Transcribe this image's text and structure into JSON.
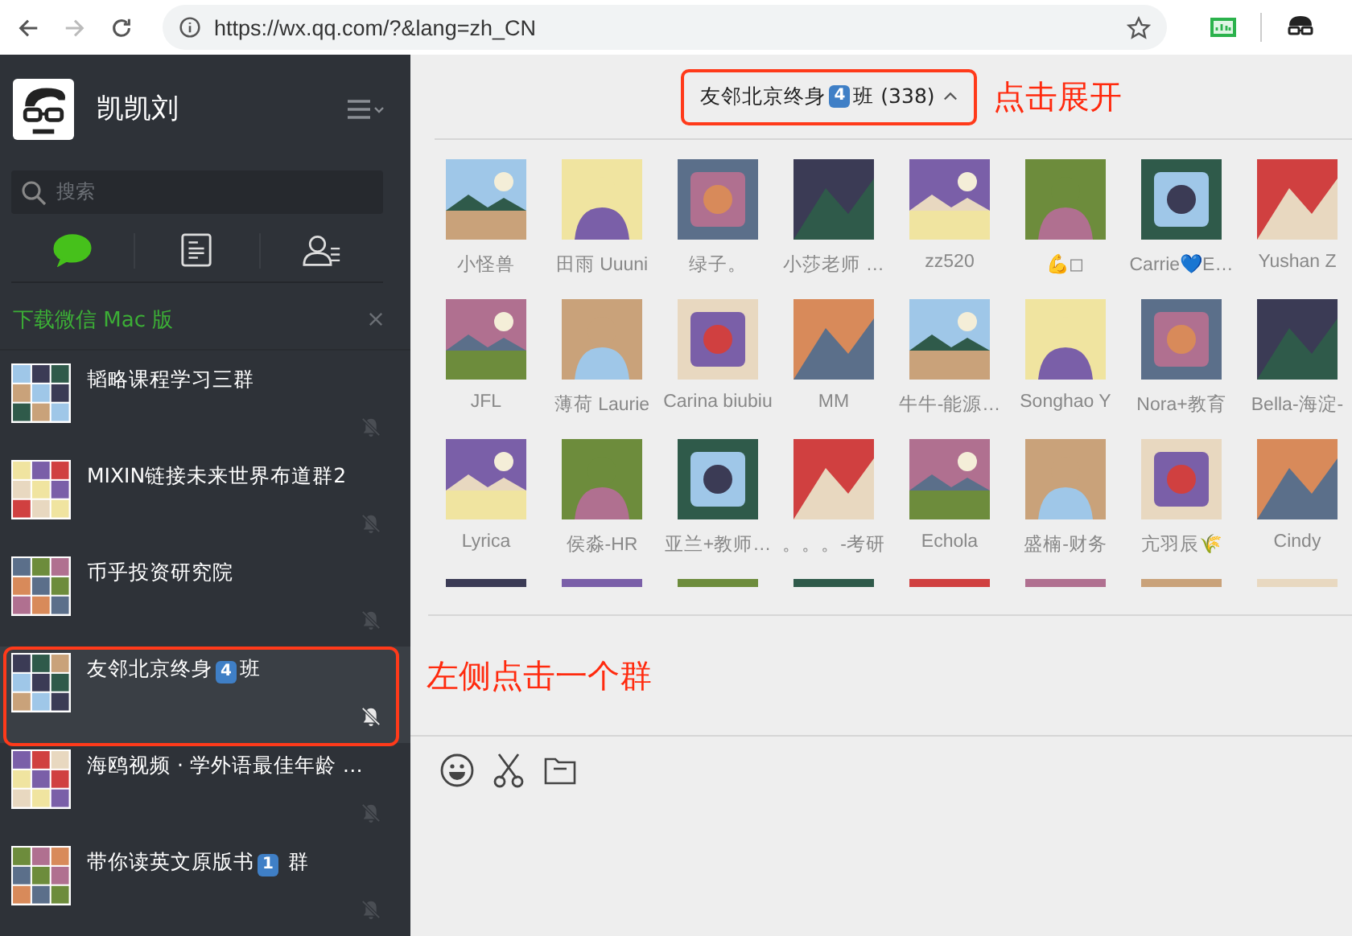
{
  "browser": {
    "url": "https://wx.qq.com/?&lang=zh_CN"
  },
  "sidebar": {
    "user_name": "凯凯刘",
    "search": {
      "placeholder": "搜索"
    },
    "tabs": [
      {
        "kind": "chats",
        "selected": true
      },
      {
        "kind": "articles",
        "selected": false
      },
      {
        "kind": "contacts",
        "selected": false
      }
    ],
    "banner": "下载微信 Mac 版",
    "chats": [
      {
        "name_parts": [
          {
            "text": "韬略课程学习三群"
          }
        ],
        "muted": true,
        "selected": false
      },
      {
        "name_parts": [
          {
            "text": "MIXIN链接未来世界布道群2"
          }
        ],
        "muted": true,
        "selected": false
      },
      {
        "name_parts": [
          {
            "text": "币乎投资研究院"
          }
        ],
        "muted": true,
        "selected": false
      },
      {
        "name_parts": [
          {
            "text": "友邻北京终身"
          },
          {
            "badge": "4"
          },
          {
            "text": "班"
          }
        ],
        "muted": true,
        "selected": true
      },
      {
        "name_parts": [
          {
            "text": "海鸥视频 · 学外语最佳年龄 …"
          }
        ],
        "muted": true,
        "selected": false
      },
      {
        "name_parts": [
          {
            "text": "带你读英文原版书"
          },
          {
            "badge": "1"
          },
          {
            "text": " 群"
          }
        ],
        "muted": true,
        "selected": false
      }
    ]
  },
  "chat": {
    "title_parts": [
      {
        "text": "友邻北京终身"
      },
      {
        "badge": "4"
      },
      {
        "text": "班 (338)"
      }
    ],
    "members": [
      {
        "name": "小怪兽"
      },
      {
        "name": "田雨 Uuuni"
      },
      {
        "name": "绿子。"
      },
      {
        "name": "小莎老师 …"
      },
      {
        "name": "zz520"
      },
      {
        "name": "💪◻"
      },
      {
        "name": "Carrie💙E…"
      },
      {
        "name": "Yushan Z"
      },
      {
        "name": "JFL"
      },
      {
        "name": "薄荷 Laurie"
      },
      {
        "name": "Carina biubiu"
      },
      {
        "name": "MM"
      },
      {
        "name": "牛牛-能源…"
      },
      {
        "name": "Songhao Y"
      },
      {
        "name": "Nora+教育"
      },
      {
        "name": "Bella-海淀-"
      },
      {
        "name": "Lyrica"
      },
      {
        "name": "侯淼-HR"
      },
      {
        "name": "亚兰+教师…"
      },
      {
        "name": "。。。-考研"
      },
      {
        "name": "Echola"
      },
      {
        "name": "盛楠-财务"
      },
      {
        "name": "亢羽辰🌾"
      },
      {
        "name": "Cindy"
      }
    ]
  },
  "annotations": [
    {
      "text": "点击展开"
    },
    {
      "text": "左侧点击一个群"
    }
  ]
}
